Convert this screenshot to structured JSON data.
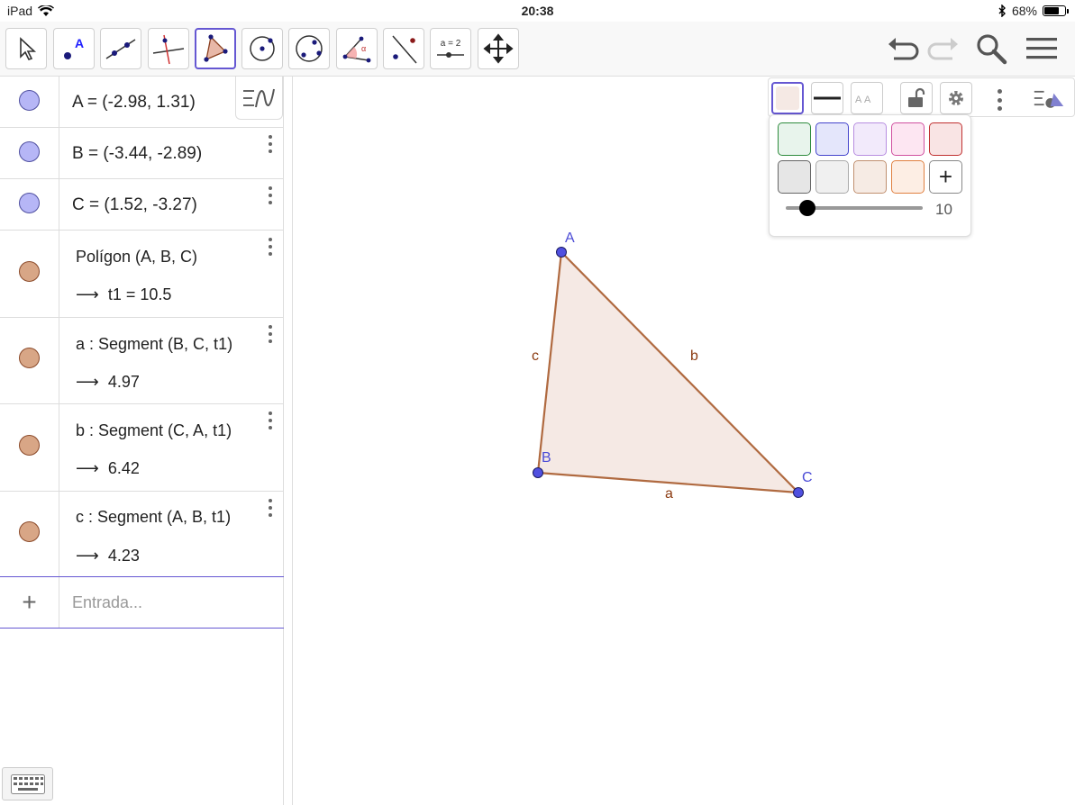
{
  "status": {
    "device": "iPad",
    "time": "20:38",
    "battery": "68%",
    "battery_level": 0.68
  },
  "toolbar": {
    "tools": [
      "move-tool",
      "point-tool",
      "line-tool",
      "perpendicular-tool",
      "polygon-tool",
      "circle-center-tool",
      "circle-three-points-tool",
      "angle-tool",
      "reflect-tool",
      "slider-tool",
      "move-graphics-tool"
    ],
    "selected": "polygon-tool",
    "slider_tool_label": "a = 2"
  },
  "algebra": {
    "rows": [
      {
        "text": "A = (-2.98, 1.31)",
        "color": "#b6b6f6"
      },
      {
        "text": "B = (-3.44, -2.89)",
        "color": "#b6b6f6"
      },
      {
        "text": "C = (1.52, -3.27)",
        "color": "#b6b6f6"
      },
      {
        "text": "Polígon (A, B, C)",
        "output": "t1 = 10.5",
        "color": "#d8a686"
      },
      {
        "text": "a : Segment (B, C, t1)",
        "output": "4.97",
        "color": "#d8a686"
      },
      {
        "text": "b : Segment (C, A, t1)",
        "output": "6.42",
        "color": "#d8a686"
      },
      {
        "text": "c : Segment (A, B, t1)",
        "output": "4.23",
        "color": "#d8a686"
      }
    ],
    "input_placeholder": "Entrada..."
  },
  "graphics": {
    "points": {
      "A": "A",
      "B": "B",
      "C": "C"
    },
    "segments": {
      "a": "a",
      "b": "b",
      "c": "c"
    },
    "polygon_fill": "#f5e9e4",
    "segment_color": "#b06a40",
    "point_color": "#5050e0",
    "label_color_points": "#4b4bd6",
    "label_color_segments": "#8b3a10"
  },
  "color_popup": {
    "swatches_row1": [
      {
        "fill": "#e8f4ec",
        "border": "#2e8b3d"
      },
      {
        "fill": "#e4e6fb",
        "border": "#4444cc"
      },
      {
        "fill": "#f2eafb",
        "border": "#b88ee0"
      },
      {
        "fill": "#fde6f2",
        "border": "#d050a0"
      },
      {
        "fill": "#f9e4e4",
        "border": "#c03030"
      }
    ],
    "swatches_row2": [
      {
        "fill": "#e6e6e6",
        "border": "#666666"
      },
      {
        "fill": "#f0f0f0",
        "border": "#aaaaaa"
      },
      {
        "fill": "#f6ebe4",
        "border": "#c09070"
      },
      {
        "fill": "#fdeee4",
        "border": "#e08040"
      }
    ],
    "add_label": "+",
    "opacity_value": "10",
    "opacity_fraction": 0.1
  }
}
